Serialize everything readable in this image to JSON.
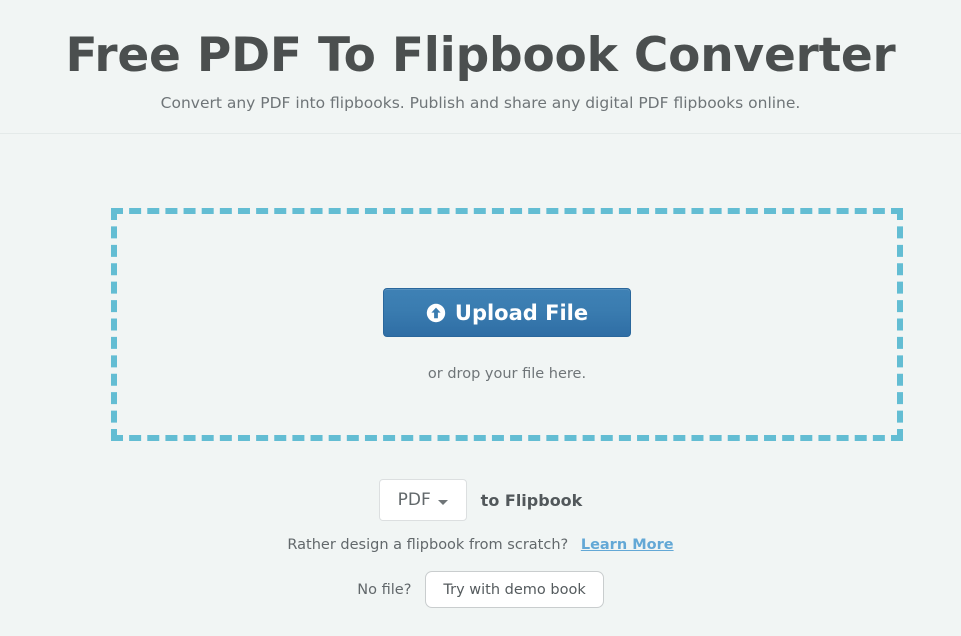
{
  "header": {
    "title": "Free PDF To Flipbook Converter",
    "subtitle": "Convert any PDF into flipbooks. Publish and share any digital PDF flipbooks online."
  },
  "dropzone": {
    "upload_label": "Upload File",
    "upload_icon": "arrow-up-circle-icon",
    "drop_hint": "or drop your file here."
  },
  "convert": {
    "format_value": "PDF",
    "format_options": [
      "PDF"
    ],
    "caret_icon": "chevron-down-icon",
    "target_label": "to Flipbook"
  },
  "scratch": {
    "question": "Rather design a flipbook from scratch?",
    "link_label": "Learn More"
  },
  "demo": {
    "no_file_label": "No file?",
    "demo_button_label": "Try with demo book"
  },
  "colors": {
    "background": "#f1f5f4",
    "title": "#4b4f4f",
    "body_text": "#62686b",
    "dropzone_border": "#63bdd3",
    "upload_button": "#3a7cb0",
    "link": "#63a8d6",
    "panel": "#ffffff"
  }
}
